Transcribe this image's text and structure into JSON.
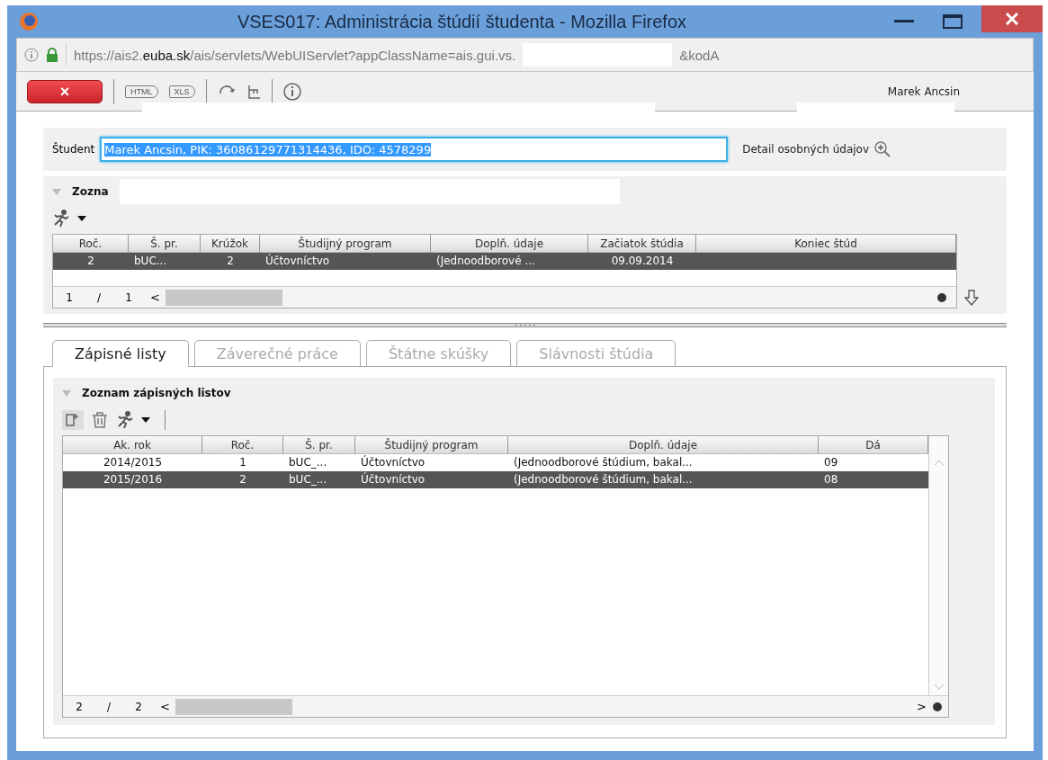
{
  "window": {
    "title": "VSES017: Administrácia štúdií študenta - Mozilla Firefox"
  },
  "address_bar": {
    "url": "https://ais2.**euba.sk**/ais/servlets/WebUIServlet?appClassName=ais.gui.vs.",
    "url_end": "&kodA"
  },
  "toolbar": {
    "close_label": "×",
    "export_buttons": [
      "HTML",
      "XLS"
    ],
    "user_name": "Marek Ancsin"
  },
  "student": {
    "label": "Študent",
    "value": "Marek Ancsin, PIK: 36086129771314436, IDO: 4578299",
    "detail_link": "Detail osobných údajov"
  },
  "study_section": {
    "title": "Zozna",
    "columns": [
      "Roč.",
      "Š. pr.",
      "Krúžok",
      "Študijný program",
      "Doplň. údaje",
      "Začiatok štúdia",
      "Koniec štúd"
    ],
    "rows": [
      {
        "cells": [
          "2",
          "bUC...",
          "2",
          "Účtovníctvo",
          "(Jednoodborové ...",
          "09.09.2014",
          ""
        ],
        "selected": true
      }
    ],
    "pager": [
      "1",
      "/",
      "1",
      "<"
    ]
  },
  "tabs": [
    {
      "label": "Zápisné listy",
      "selected": true
    },
    {
      "label": "Záverečné práce",
      "selected": false
    },
    {
      "label": "Štátne skúšky",
      "selected": false
    },
    {
      "label": "Slávnosti štúdia",
      "selected": false
    }
  ],
  "enrollment_section": {
    "title": "Zoznam zápisných listov",
    "columns": [
      "Ak. rok",
      "Roč.",
      "Š. pr.",
      "Študijný program",
      "Doplň. údaje",
      "Dá"
    ],
    "rows": [
      {
        "cells": [
          "2014/2015",
          "1",
          "bUC_...",
          "Účtovníctvo",
          "(Jednoodborové štúdium, bakal...",
          "09"
        ],
        "selected": false
      },
      {
        "cells": [
          "2015/2016",
          "2",
          "bUC_...",
          "Účtovníctvo",
          "(Jednoodborové štúdium, bakal...",
          "08"
        ],
        "selected": true
      }
    ],
    "pager": [
      "2",
      "/",
      "2",
      "<",
      ">"
    ]
  }
}
